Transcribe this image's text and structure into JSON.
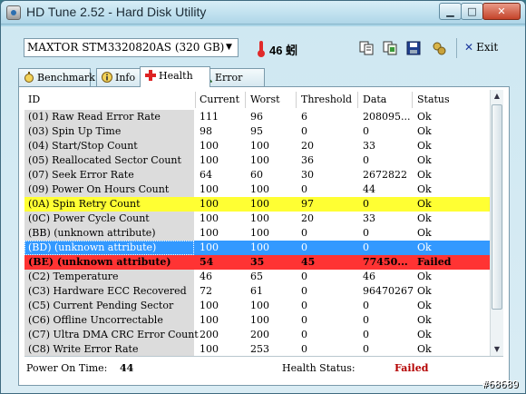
{
  "window": {
    "title": "HD Tune 2.52 - Hard Disk Utility",
    "min_glyph": "▁",
    "max_glyph": "□",
    "close_glyph": "✕"
  },
  "toolbar": {
    "drive": "MAXTOR STM3320820AS (320 GB)",
    "drive_arrow": "▼",
    "temperature": "46 蚓",
    "exit_label": "Exit",
    "exit_glyph": "✕"
  },
  "tabs": [
    {
      "label": "Benchmark",
      "icon": "stopwatch-icon"
    },
    {
      "label": "Info",
      "icon": "info-icon"
    },
    {
      "label": "Health",
      "icon": "health-cross-icon",
      "active": true
    },
    {
      "label": "Error Scan",
      "icon": "magnifier-icon"
    }
  ],
  "table": {
    "headers": [
      "ID",
      "Current",
      "Worst",
      "Threshold",
      "Data",
      "Status"
    ],
    "rows": [
      {
        "id": "(01) Raw Read Error Rate",
        "current": "111",
        "worst": "96",
        "threshold": "6",
        "data": "208095...",
        "status": "Ok",
        "style": "normal"
      },
      {
        "id": "(03) Spin Up Time",
        "current": "98",
        "worst": "95",
        "threshold": "0",
        "data": "0",
        "status": "Ok",
        "style": "normal"
      },
      {
        "id": "(04) Start/Stop Count",
        "current": "100",
        "worst": "100",
        "threshold": "20",
        "data": "33",
        "status": "Ok",
        "style": "normal"
      },
      {
        "id": "(05) Reallocated Sector Count",
        "current": "100",
        "worst": "100",
        "threshold": "36",
        "data": "0",
        "status": "Ok",
        "style": "normal"
      },
      {
        "id": "(07) Seek Error Rate",
        "current": "64",
        "worst": "60",
        "threshold": "30",
        "data": "2672822",
        "status": "Ok",
        "style": "normal"
      },
      {
        "id": "(09) Power On Hours Count",
        "current": "100",
        "worst": "100",
        "threshold": "0",
        "data": "44",
        "status": "Ok",
        "style": "normal"
      },
      {
        "id": "(0A) Spin Retry Count",
        "current": "100",
        "worst": "100",
        "threshold": "97",
        "data": "0",
        "status": "Ok",
        "style": "warning"
      },
      {
        "id": "(0C) Power Cycle Count",
        "current": "100",
        "worst": "100",
        "threshold": "20",
        "data": "33",
        "status": "Ok",
        "style": "normal"
      },
      {
        "id": "(BB) (unknown attribute)",
        "current": "100",
        "worst": "100",
        "threshold": "0",
        "data": "0",
        "status": "Ok",
        "style": "normal"
      },
      {
        "id": "(BD) (unknown attribute)",
        "current": "100",
        "worst": "100",
        "threshold": "0",
        "data": "0",
        "status": "Ok",
        "style": "selected"
      },
      {
        "id": "(BE) (unknown attribute)",
        "current": "54",
        "worst": "35",
        "threshold": "45",
        "data": "77450...",
        "status": "Failed",
        "style": "failed"
      },
      {
        "id": "(C2) Temperature",
        "current": "46",
        "worst": "65",
        "threshold": "0",
        "data": "46",
        "status": "Ok",
        "style": "normal"
      },
      {
        "id": "(C3) Hardware ECC Recovered",
        "current": "72",
        "worst": "61",
        "threshold": "0",
        "data": "96470267",
        "status": "Ok",
        "style": "normal"
      },
      {
        "id": "(C5) Current Pending Sector",
        "current": "100",
        "worst": "100",
        "threshold": "0",
        "data": "0",
        "status": "Ok",
        "style": "normal"
      },
      {
        "id": "(C6) Offline Uncorrectable",
        "current": "100",
        "worst": "100",
        "threshold": "0",
        "data": "0",
        "status": "Ok",
        "style": "normal"
      },
      {
        "id": "(C7) Ultra DMA CRC Error Count",
        "current": "200",
        "worst": "200",
        "threshold": "0",
        "data": "0",
        "status": "Ok",
        "style": "normal"
      },
      {
        "id": "(C8) Write Error Rate",
        "current": "100",
        "worst": "253",
        "threshold": "0",
        "data": "0",
        "status": "Ok",
        "style": "normal"
      }
    ]
  },
  "scrollbar": {
    "up_glyph": "▲",
    "down_glyph": "▼"
  },
  "status": {
    "power_on_label": "Power On Time:",
    "power_on_value": "44",
    "health_label": "Health Status:",
    "health_value": "Failed"
  },
  "watermark": "#68689",
  "colors": {
    "warning_row": "#ffff33",
    "selected_row": "#3399ff",
    "failed_row": "#ff3333",
    "failed_text": "#b40000"
  }
}
